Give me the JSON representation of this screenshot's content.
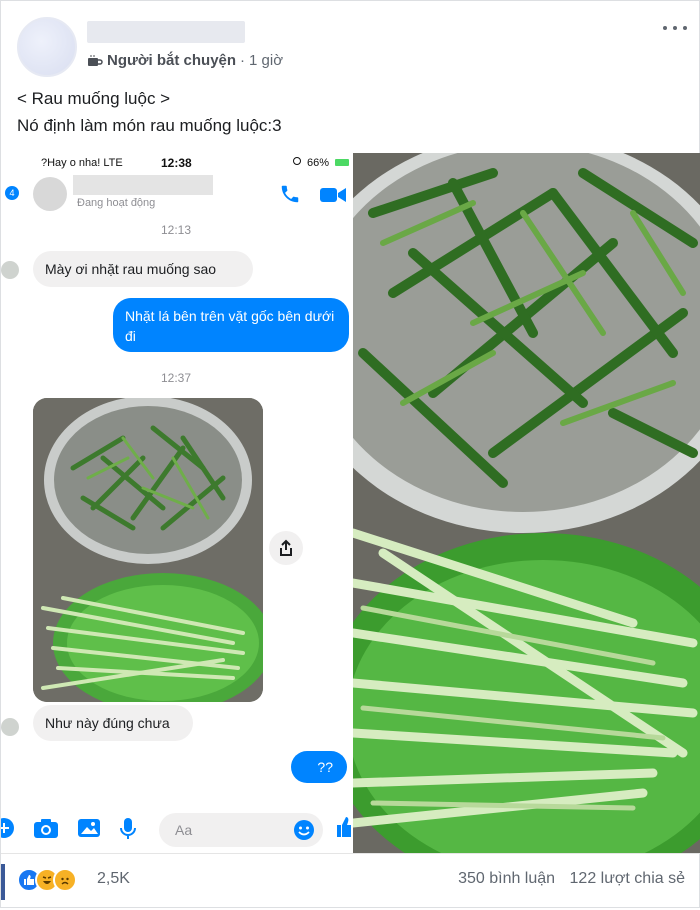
{
  "post": {
    "group_badge": "Người bắt chuyện",
    "time_sep": "·",
    "time": "1 giờ",
    "caption_line1": "< Rau muống luộc >",
    "caption_line2": "Nó định làm món rau muống luộc:3"
  },
  "phone": {
    "carrier": "?Hay o nha!  LTE",
    "time": "12:38",
    "battery": "66%",
    "unread_count": "4",
    "contact_status": "Đang hoạt động",
    "time_sep_1": "12:13",
    "msg_in_1": "Mày ơi nhặt rau muống sao",
    "msg_out_1": "Nhặt lá bên trên vặt gốc bên dưới đi",
    "time_sep_2": "12:37",
    "msg_in_2": "Như này đúng chưa",
    "msg_out_2": "??",
    "composer_placeholder": "Aa"
  },
  "footer": {
    "reaction_count": "2,5K",
    "comments": "350 bình luận",
    "shares": "122 lượt chia sẻ"
  },
  "icons": [
    "coffee-icon",
    "more-icon",
    "phone-icon",
    "video-icon",
    "share-icon",
    "plus-icon",
    "camera-icon",
    "gallery-icon",
    "mic-icon",
    "emoji-icon",
    "like-icon",
    "haha-icon",
    "sad-icon"
  ],
  "colors": {
    "messenger_blue": "#0084ff",
    "bubble_gray": "#f1f0f0",
    "facebook_blue": "#3b5998"
  }
}
